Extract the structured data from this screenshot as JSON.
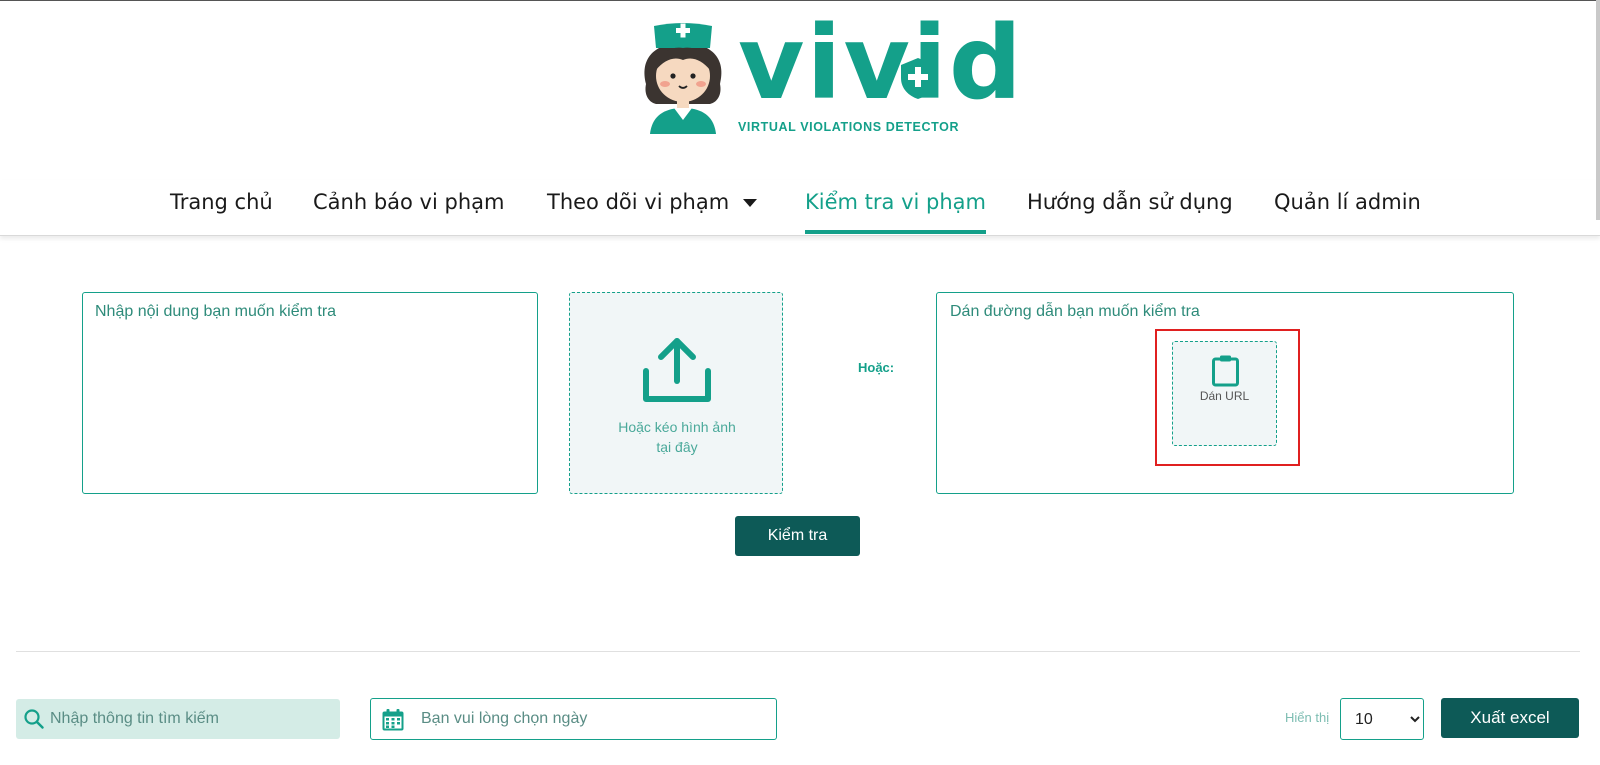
{
  "brand": {
    "name": "vivid",
    "tagline": "VIRTUAL VIOLATIONS DETECTOR",
    "color": "#14a08a"
  },
  "nav": {
    "items": [
      {
        "label": "Trang chủ"
      },
      {
        "label": "Cảnh báo vi phạm"
      },
      {
        "label": "Theo dõi vi phạm"
      },
      {
        "label": "Kiểm tra vi phạm",
        "active": true
      },
      {
        "label": "Hướng dẫn sử dụng"
      },
      {
        "label": "Quản lí admin"
      }
    ]
  },
  "check": {
    "text_placeholder": "Nhập nội dung bạn muốn kiểm tra",
    "upload_label_line1": "Hoặc kéo hình ảnh",
    "upload_label_line2": "tại đây",
    "or_label": "Hoặc:",
    "url_placeholder": "Dán đường dẫn bạn muốn kiểm tra",
    "paste_label": "Dán URL",
    "submit_label": "Kiểm tra"
  },
  "filters": {
    "search_placeholder": "Nhập thông tin tìm kiếm",
    "date_placeholder": "Bạn vui lòng chọn ngày",
    "show_label": "Hiển thị",
    "page_size": "10",
    "export_label": "Xuất excel"
  },
  "colors": {
    "accent": "#14a08a",
    "dark_button": "#0d5a57",
    "highlight": "#e02020"
  }
}
